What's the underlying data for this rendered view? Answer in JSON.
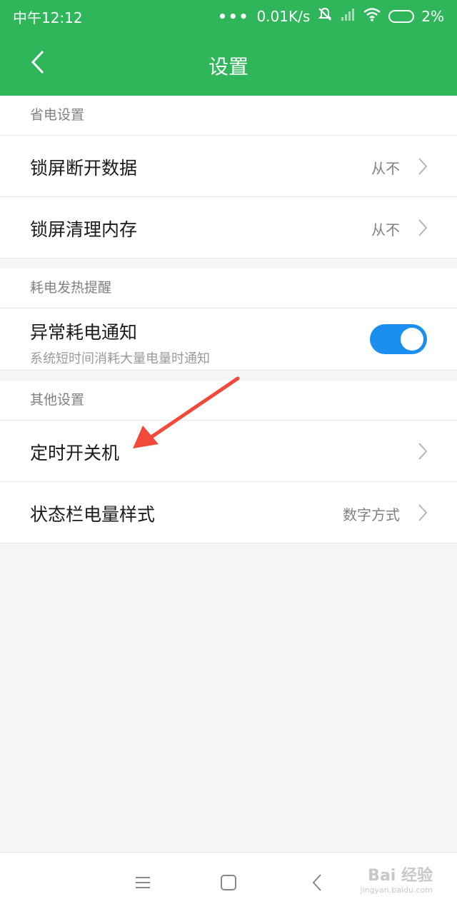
{
  "status_bar": {
    "time": "中午12:12",
    "dots": "•••",
    "speed": "0.01K/s",
    "battery": "2%"
  },
  "title_bar": {
    "title": "设置"
  },
  "sections": [
    {
      "header": "省电设置",
      "rows": [
        {
          "label": "锁屏断开数据",
          "value": "从不"
        },
        {
          "label": "锁屏清理内存",
          "value": "从不"
        }
      ]
    },
    {
      "header": "耗电发热提醒",
      "rows": [
        {
          "label": "异常耗电通知",
          "sub": "系统短时间消耗大量电量时通知",
          "toggle": true
        }
      ]
    },
    {
      "header": "其他设置",
      "rows": [
        {
          "label": "定时开关机",
          "value": ""
        },
        {
          "label": "状态栏电量样式",
          "value": "数字方式"
        }
      ]
    }
  ],
  "watermark": {
    "main": "Bai 经验",
    "url": "jingyan.baidu.com"
  },
  "colors": {
    "primary_green": "#2fb65a",
    "toggle_blue": "#1a8ff0",
    "arrow_red": "#f24a3a"
  }
}
